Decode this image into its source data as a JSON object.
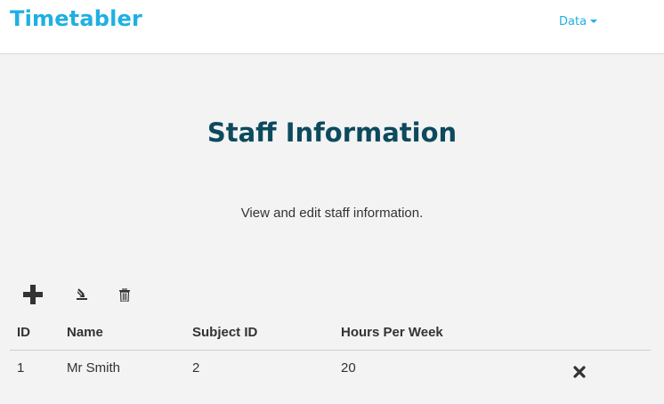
{
  "navbar": {
    "brand": "Timetabler",
    "data_menu": "Data"
  },
  "page": {
    "title": "Staff Information",
    "description": "View and edit staff information."
  },
  "toolbar": {
    "add_icon": "plus-icon",
    "import_icon": "import-icon",
    "delete_icon": "trash-icon"
  },
  "table": {
    "columns": [
      "ID",
      "Name",
      "Subject ID",
      "Hours Per Week"
    ],
    "rows": [
      {
        "id": "1",
        "name": "Mr Smith",
        "subject_id": "2",
        "hours_per_week": "20",
        "action_icon": "close-icon"
      }
    ]
  },
  "colors": {
    "brand": "#1fb0e3",
    "title": "#0d4a5e",
    "background": "#f3f3f3"
  }
}
